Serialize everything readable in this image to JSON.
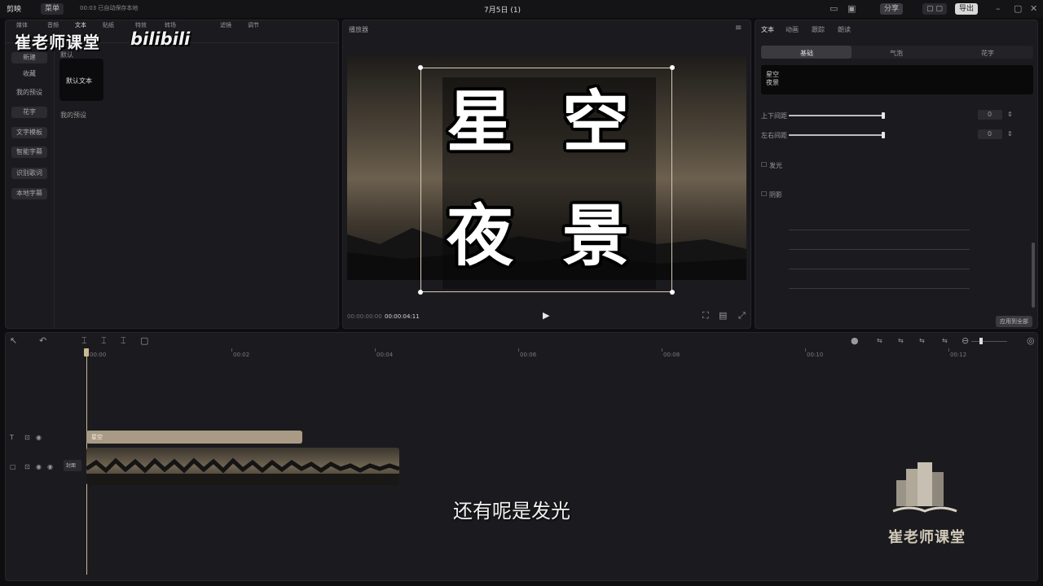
{
  "app": {
    "logo_label": "剪映",
    "top_chip": "菜单",
    "autosave": "00:03 已自动保存本地",
    "title": "7月5日 (1)",
    "export_label": "导出",
    "share_label": "分享"
  },
  "watermark": {
    "channel": "崔老师课堂",
    "platform": "bilibili",
    "bottom_logo": "崔老师课堂"
  },
  "media_tabs": [
    "媒体",
    "音频",
    "文本",
    "贴纸",
    "特效",
    "转场",
    "滤镜",
    "调节"
  ],
  "left_sidebar": [
    "新建",
    "收藏",
    "我的预设",
    "花字",
    "文字模板",
    "智能字幕",
    "识别歌词",
    "本地字幕"
  ],
  "text_asset": {
    "section_label": "默认",
    "tile_label": "默认文本",
    "subheading": "我的预设"
  },
  "player": {
    "title": "播放器",
    "current_time": "00:00:00:00",
    "total_time": "00:00:04:11",
    "overlay_line1": [
      "星",
      "空"
    ],
    "overlay_line2": [
      "夜",
      "景"
    ]
  },
  "inspector": {
    "tabs": [
      "文本",
      "动画",
      "跟踪",
      "朗读"
    ],
    "subtabs": [
      "基础",
      "气泡",
      "花字"
    ],
    "text_preview_line1": "星空",
    "text_preview_line2": "夜景",
    "rows": [
      {
        "label": "上下间距",
        "value": "0",
        "level": 0.95
      },
      {
        "label": "左右间距",
        "value": "0",
        "level": 0.95
      }
    ],
    "section_glow": "发光",
    "section_shadow": "阴影",
    "apply_button": "应用到全部"
  },
  "timeline": {
    "ruler": [
      "00:00",
      "00:02",
      "00:04",
      "00:06",
      "00:08",
      "00:10",
      "00:12"
    ],
    "text_clip_label": "星空",
    "video_track_label": "封面"
  },
  "subtitle": "还有呢是发光",
  "colors": {
    "accent": "#d8cbb4",
    "text_clip": "#a89a84",
    "playhead": "#c9b994",
    "bg": "#0e0e10",
    "panel": "#1b1b1f"
  }
}
